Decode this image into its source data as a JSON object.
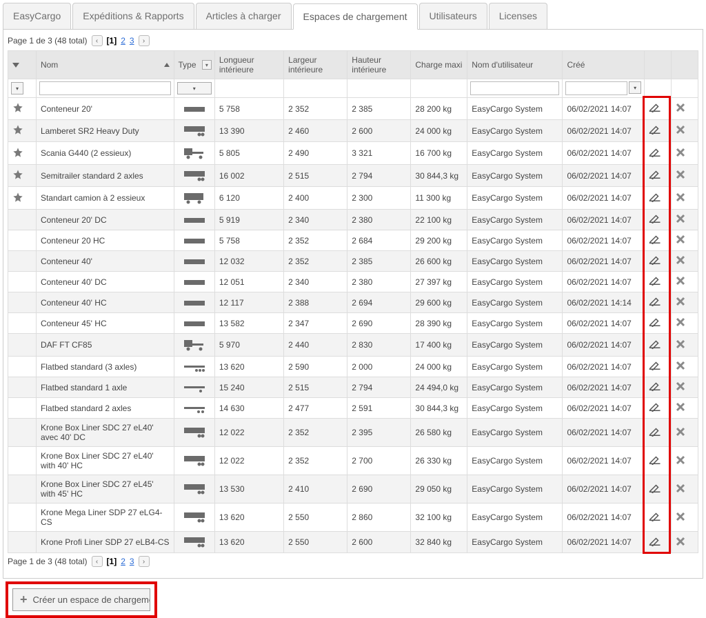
{
  "tabs": [
    "EasyCargo",
    "Expéditions & Rapports",
    "Articles à charger",
    "Espaces de chargement",
    "Utilisateurs",
    "Licenses"
  ],
  "activeTab": 3,
  "pager": {
    "label_prefix": "Page",
    "page": "1",
    "of_word": "de",
    "total_pages": "3",
    "total_items_label": "(48 total)",
    "pages": [
      "1",
      "2",
      "3"
    ]
  },
  "columns": {
    "fav": "",
    "nom": "Nom",
    "type": "Type",
    "longueur": "Longueur intérieure",
    "largeur": "Largeur intérieure",
    "hauteur": "Hauteur intérieure",
    "charge": "Charge maxi",
    "user": "Nom d'utilisateur",
    "cree": "Créé",
    "edit": "",
    "del": ""
  },
  "rows": [
    {
      "fav": true,
      "nom": "Conteneur 20'",
      "type": "container",
      "longueur": "5 758",
      "largeur": "2 352",
      "hauteur": "2 385",
      "charge": "28 200 kg",
      "user": "EasyCargo System",
      "cree": "06/02/2021 14:07"
    },
    {
      "fav": true,
      "nom": "Lamberet SR2 Heavy Duty",
      "type": "semitrailer",
      "longueur": "13 390",
      "largeur": "2 460",
      "hauteur": "2 600",
      "charge": "24 000 kg",
      "user": "EasyCargo System",
      "cree": "06/02/2021 14:07"
    },
    {
      "fav": true,
      "nom": "Scania G440 (2 essieux)",
      "type": "truck",
      "longueur": "5 805",
      "largeur": "2 490",
      "hauteur": "3 321",
      "charge": "16 700 kg",
      "user": "EasyCargo System",
      "cree": "06/02/2021 14:07"
    },
    {
      "fav": true,
      "nom": "Semitrailer standard 2 axles",
      "type": "semitrailer",
      "longueur": "16 002",
      "largeur": "2 515",
      "hauteur": "2 794",
      "charge": "30 844,3 kg",
      "user": "EasyCargo System",
      "cree": "06/02/2021 14:07"
    },
    {
      "fav": true,
      "nom": "Standart camion à 2 essieux",
      "type": "boxtruck",
      "longueur": "6 120",
      "largeur": "2 400",
      "hauteur": "2 300",
      "charge": "11 300 kg",
      "user": "EasyCargo System",
      "cree": "06/02/2021 14:07"
    },
    {
      "fav": false,
      "nom": "Conteneur 20' DC",
      "type": "container",
      "longueur": "5 919",
      "largeur": "2 340",
      "hauteur": "2 380",
      "charge": "22 100 kg",
      "user": "EasyCargo System",
      "cree": "06/02/2021 14:07"
    },
    {
      "fav": false,
      "nom": "Conteneur 20 HC",
      "type": "container",
      "longueur": "5 758",
      "largeur": "2 352",
      "hauteur": "2 684",
      "charge": "29 200 kg",
      "user": "EasyCargo System",
      "cree": "06/02/2021 14:07"
    },
    {
      "fav": false,
      "nom": "Conteneur 40'",
      "type": "container",
      "longueur": "12 032",
      "largeur": "2 352",
      "hauteur": "2 385",
      "charge": "26 600 kg",
      "user": "EasyCargo System",
      "cree": "06/02/2021 14:07"
    },
    {
      "fav": false,
      "nom": "Conteneur 40' DC",
      "type": "container",
      "longueur": "12 051",
      "largeur": "2 340",
      "hauteur": "2 380",
      "charge": "27 397 kg",
      "user": "EasyCargo System",
      "cree": "06/02/2021 14:07"
    },
    {
      "fav": false,
      "nom": "Conteneur 40' HC",
      "type": "container",
      "longueur": "12 117",
      "largeur": "2 388",
      "hauteur": "2 694",
      "charge": "29 600 kg",
      "user": "EasyCargo System",
      "cree": "06/02/2021 14:14"
    },
    {
      "fav": false,
      "nom": "Conteneur 45' HC",
      "type": "container",
      "longueur": "13 582",
      "largeur": "2 347",
      "hauteur": "2 690",
      "charge": "28 390 kg",
      "user": "EasyCargo System",
      "cree": "06/02/2021 14:07"
    },
    {
      "fav": false,
      "nom": "DAF FT CF85",
      "type": "truck",
      "longueur": "5 970",
      "largeur": "2 440",
      "hauteur": "2 830",
      "charge": "17 400 kg",
      "user": "EasyCargo System",
      "cree": "06/02/2021 14:07"
    },
    {
      "fav": false,
      "nom": "Flatbed standard (3 axles)",
      "type": "flatbed3",
      "longueur": "13 620",
      "largeur": "2 590",
      "hauteur": "2 000",
      "charge": "24 000 kg",
      "user": "EasyCargo System",
      "cree": "06/02/2021 14:07"
    },
    {
      "fav": false,
      "nom": "Flatbed standard 1 axle",
      "type": "flatbed1",
      "longueur": "15 240",
      "largeur": "2 515",
      "hauteur": "2 794",
      "charge": "24 494,0 kg",
      "user": "EasyCargo System",
      "cree": "06/02/2021 14:07"
    },
    {
      "fav": false,
      "nom": "Flatbed standard 2 axles",
      "type": "flatbed2",
      "longueur": "14 630",
      "largeur": "2 477",
      "hauteur": "2 591",
      "charge": "30 844,3 kg",
      "user": "EasyCargo System",
      "cree": "06/02/2021 14:07"
    },
    {
      "fav": false,
      "nom": "Krone Box Liner SDC 27 eL40' avec 40' DC",
      "type": "semitrailer",
      "longueur": "12 022",
      "largeur": "2 352",
      "hauteur": "2 395",
      "charge": "26 580 kg",
      "user": "EasyCargo System",
      "cree": "06/02/2021 14:07"
    },
    {
      "fav": false,
      "nom": "Krone Box Liner SDC 27 eL40' with 40' HC",
      "type": "semitrailer",
      "longueur": "12 022",
      "largeur": "2 352",
      "hauteur": "2 700",
      "charge": "26 330 kg",
      "user": "EasyCargo System",
      "cree": "06/02/2021 14:07"
    },
    {
      "fav": false,
      "nom": "Krone Box Liner SDC 27 eL45' with 45' HC",
      "type": "semitrailer",
      "longueur": "13 530",
      "largeur": "2 410",
      "hauteur": "2 690",
      "charge": "29 050 kg",
      "user": "EasyCargo System",
      "cree": "06/02/2021 14:07"
    },
    {
      "fav": false,
      "nom": "Krone Mega Liner SDP 27 eLG4-CS",
      "type": "semitrailer",
      "longueur": "13 620",
      "largeur": "2 550",
      "hauteur": "2 860",
      "charge": "32 100 kg",
      "user": "EasyCargo System",
      "cree": "06/02/2021 14:07"
    },
    {
      "fav": false,
      "nom": "Krone Profi Liner SDP 27 eLB4-CS",
      "type": "semitrailer",
      "longueur": "13 620",
      "largeur": "2 550",
      "hauteur": "2 600",
      "charge": "32 840 kg",
      "user": "EasyCargo System",
      "cree": "06/02/2021 14:07"
    }
  ],
  "createButton": "Créer un espace de chargeme"
}
